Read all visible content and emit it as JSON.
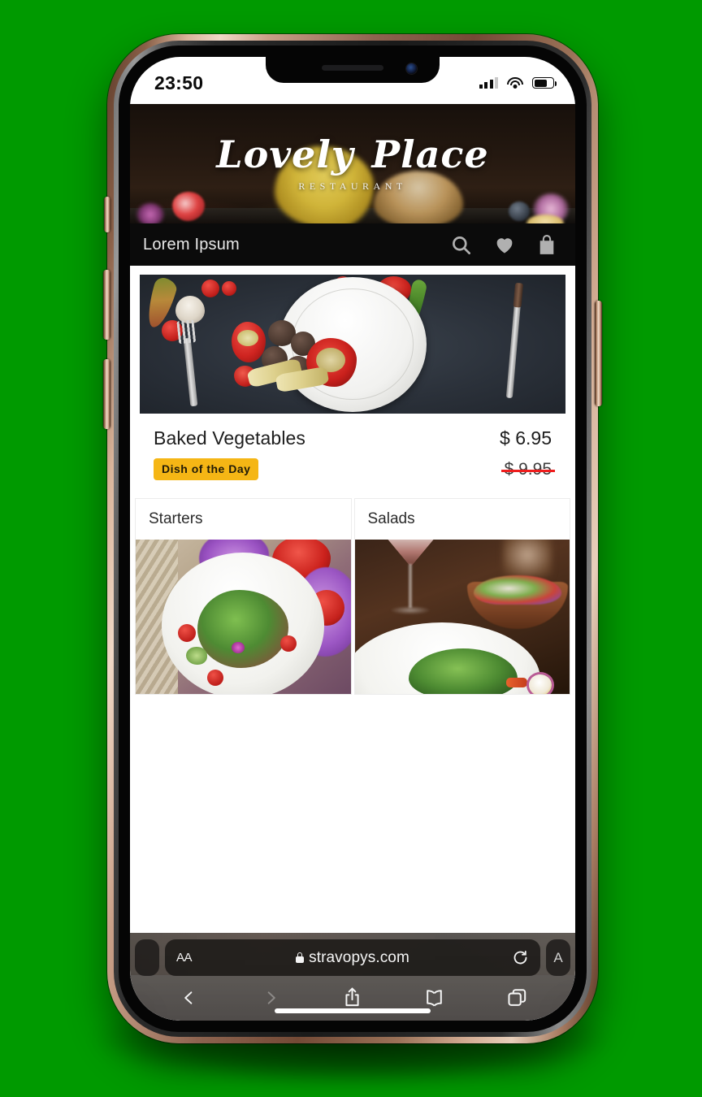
{
  "device": {
    "frame_color": "#c9a088",
    "background_color": "#009A00"
  },
  "status_bar": {
    "time": "23:50",
    "cellular_icon": "cellular-signal-icon",
    "wifi_icon": "wifi-icon",
    "battery_icon": "battery-icon"
  },
  "site": {
    "hero": {
      "logo_line1": "Lovely",
      "logo_line2": "Place",
      "logo_subtitle": "RESTAURANT"
    },
    "navbar": {
      "title": "Lorem Ipsum",
      "icons": [
        "search-icon",
        "heart-icon",
        "shopping-bag-icon"
      ]
    },
    "featured_product": {
      "name": "Baked Vegetables",
      "price": "$ 6.95",
      "old_price": "$ 9.95",
      "badge": "Dish of the Day",
      "badge_color": "#f5b615",
      "strike_color": "#ef1d1d",
      "image_alt": "baked-vegetables-photo"
    },
    "categories": [
      {
        "label": "Starters",
        "image_alt": "starters-salad-photo"
      },
      {
        "label": "Salads",
        "image_alt": "salads-table-photo"
      }
    ]
  },
  "browser": {
    "text_size_label": "AA",
    "url": "stravopys.com",
    "lock_icon": "lock-icon",
    "reload_icon": "reload-icon",
    "left_tab_label": "",
    "right_tab_label": "A",
    "toolbar": [
      {
        "name": "back-button",
        "icon": "chevron-left-icon",
        "enabled": true
      },
      {
        "name": "forward-button",
        "icon": "chevron-right-icon",
        "enabled": false
      },
      {
        "name": "share-button",
        "icon": "share-icon",
        "enabled": true
      },
      {
        "name": "bookmarks-button",
        "icon": "book-icon",
        "enabled": true
      },
      {
        "name": "tabs-button",
        "icon": "tabs-icon",
        "enabled": true
      }
    ]
  }
}
